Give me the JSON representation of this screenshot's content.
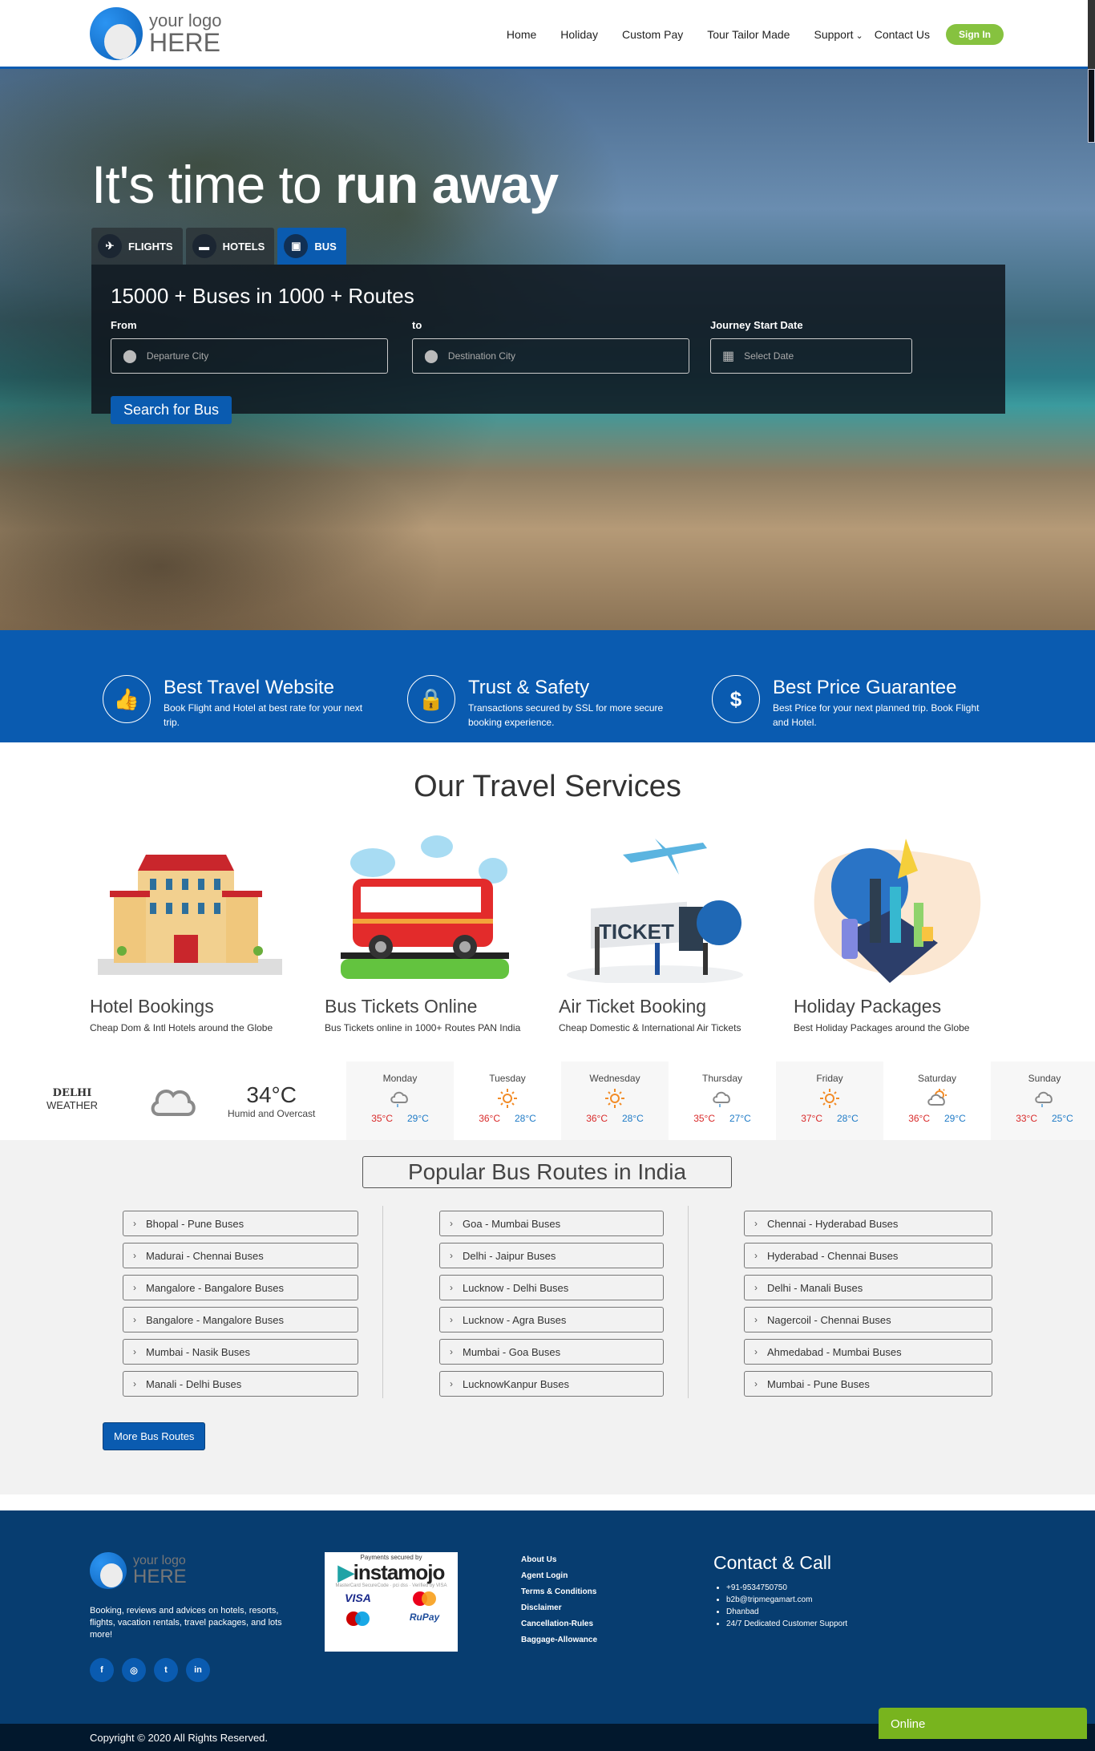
{
  "header": {
    "logo": {
      "line1": "your logo",
      "line2": "HERE"
    },
    "nav": [
      "Home",
      "Holiday",
      "Custom Pay",
      "Tour Tailor Made",
      "Support",
      "Contact Us"
    ],
    "support_chevron": "⌄",
    "signin_label": "Sign In"
  },
  "hero": {
    "title_light": "It's time to ",
    "title_bold": "run away",
    "tabs": [
      {
        "label": "FLIGHTS",
        "icon": "plane-icon",
        "glyph": "✈",
        "active": false
      },
      {
        "label": "HOTELS",
        "icon": "bed-icon",
        "glyph": "🛏",
        "active": false
      },
      {
        "label": "BUS",
        "icon": "bus-icon",
        "glyph": "🚌",
        "active": true
      }
    ],
    "search": {
      "title": "15000 + Buses in 1000 + Routes",
      "from_label": "From",
      "from_placeholder": "Departure City",
      "to_label": "to",
      "to_placeholder": "Destination City",
      "date_label": "Journey Start Date",
      "date_placeholder": "Select Date",
      "button_label": "Search for Bus"
    }
  },
  "features": [
    {
      "icon": "thumbs-up-icon",
      "glyph": "👍",
      "title": "Best Travel Website",
      "text": "Book Flight and Hotel at best rate for your next trip."
    },
    {
      "icon": "lock-icon",
      "glyph": "🔒",
      "title": "Trust & Safety",
      "text": "Transactions secured by SSL for more secure booking experience."
    },
    {
      "icon": "dollar-icon",
      "glyph": "$",
      "title": "Best Price Guarantee",
      "text": "Best Price for your next planned trip. Book Flight and Hotel."
    }
  ],
  "services": {
    "heading": "Our Travel Services",
    "items": [
      {
        "title": "Hotel Bookings",
        "text": "Cheap Dom & Intl Hotels around the Globe",
        "image": "hotel-illustration"
      },
      {
        "title": "Bus Tickets Online",
        "text": "Bus Tickets online in 1000+ Routes PAN India",
        "image": "bus-illustration"
      },
      {
        "title": "Air Ticket Booking",
        "text": "Cheap Domestic & International Air Tickets",
        "image": "air-ticket-illustration",
        "ticket_text": "TICKET"
      },
      {
        "title": "Holiday Packages",
        "text": "Best Holiday Packages around the Globe",
        "image": "holiday-illustration"
      }
    ]
  },
  "weather": {
    "city": "DELHI",
    "label": "WEATHER",
    "current_temp": "34°C",
    "current_desc": "Humid and Overcast",
    "current_icon": "cloud-icon",
    "days": [
      {
        "name": "Monday",
        "icon": "rain-cloud-icon",
        "high": "35°C",
        "low": "29°C"
      },
      {
        "name": "Tuesday",
        "icon": "sun-icon",
        "high": "36°C",
        "low": "28°C"
      },
      {
        "name": "Wednesday",
        "icon": "sun-icon",
        "high": "36°C",
        "low": "28°C"
      },
      {
        "name": "Thursday",
        "icon": "rain-cloud-icon",
        "high": "35°C",
        "low": "27°C"
      },
      {
        "name": "Friday",
        "icon": "sun-icon",
        "high": "37°C",
        "low": "28°C"
      },
      {
        "name": "Saturday",
        "icon": "partly-cloudy-icon",
        "high": "36°C",
        "low": "29°C"
      },
      {
        "name": "Sunday",
        "icon": "rain-cloud-icon",
        "high": "33°C",
        "low": "25°C"
      }
    ]
  },
  "routes": {
    "title": "Popular Bus Routes in India",
    "columns": [
      [
        "Bhopal - Pune Buses",
        "Madurai - Chennai Buses",
        "Mangalore - Bangalore Buses",
        "Bangalore - Mangalore Buses",
        "Mumbai - Nasik Buses",
        "Manali - Delhi Buses"
      ],
      [
        "Goa - Mumbai Buses",
        "Delhi - Jaipur Buses",
        "Lucknow - Delhi Buses",
        "Lucknow - Agra Buses",
        "Mumbai - Goa Buses",
        "LucknowKanpur Buses"
      ],
      [
        "Chennai - Hyderabad Buses",
        "Hyderabad - Chennai Buses",
        "Delhi - Manali Buses",
        "Nagercoil - Chennai Buses",
        "Ahmedabad - Mumbai Buses",
        "Mumbai - Pune Buses"
      ]
    ],
    "chevron": "›",
    "more_label": "More Bus Routes"
  },
  "footer": {
    "logo": {
      "line1": "your logo",
      "line2": "HERE"
    },
    "about": "Booking, reviews and advices on hotels, resorts, flights, vacation rentals, travel packages, and lots more!",
    "socials": [
      {
        "name": "facebook-icon",
        "glyph": "f"
      },
      {
        "name": "instagram-icon",
        "glyph": "◎"
      },
      {
        "name": "twitter-icon",
        "glyph": "t"
      },
      {
        "name": "linkedin-icon",
        "glyph": "in"
      }
    ],
    "payment": {
      "secured_by": "Payments secured by",
      "brand": "instamojo",
      "badges": "MasterCard SecureCode · pci dss · Verified by VISA",
      "cards": [
        "VISA",
        "mastercard",
        "maestro",
        "RuPay"
      ]
    },
    "links": [
      "About Us",
      "Agent Login",
      "Terms & Conditions",
      "Disclaimer",
      "Cancellation-Rules",
      "Baggage-Allowance"
    ],
    "contact": {
      "title": "Contact & Call",
      "items": [
        "+91-9534750750",
        "b2b@tripmegamart.com",
        "Dhanbad",
        "24/7 Dedicated Customer Support"
      ]
    },
    "copyright": "Copyright © 2020 All Rights Reserved."
  },
  "chat": {
    "label": "Online"
  },
  "colors": {
    "brand_blue": "#0a5bb0",
    "footer_blue": "#073d70",
    "signin_green": "#86c23f",
    "online_green": "#78b41e",
    "temp_high": "#d92a2a",
    "temp_low": "#1f7bc7"
  }
}
